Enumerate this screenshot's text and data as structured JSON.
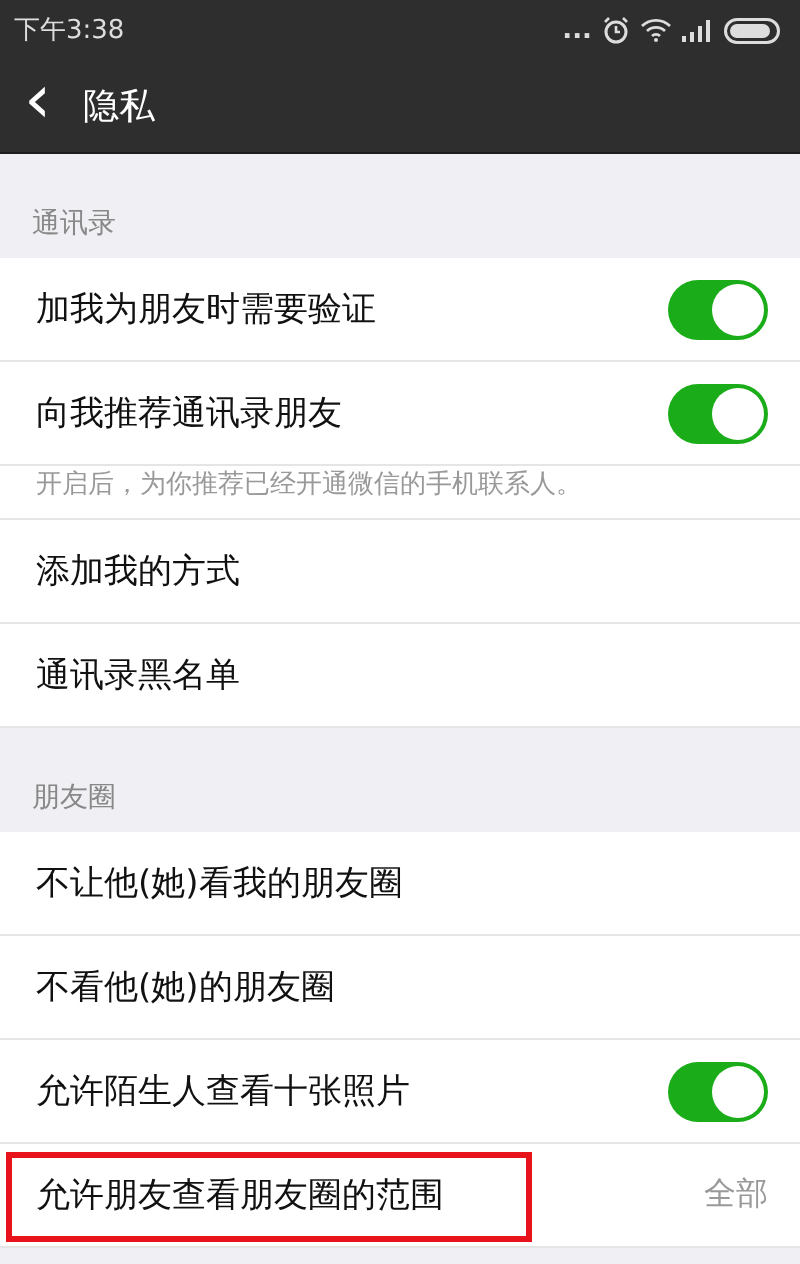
{
  "status_bar": {
    "time": "下午3:38",
    "dots": "..."
  },
  "header": {
    "back": "‹",
    "title": "隐私"
  },
  "sections": [
    {
      "title": "通讯录",
      "items": [
        {
          "kind": "toggle",
          "label": "加我为朋友时需要验证",
          "on": true
        },
        {
          "kind": "toggle",
          "label": "向我推荐通讯录朋友",
          "on": true
        },
        {
          "kind": "hint",
          "label": "开启后，为你推荐已经开通微信的手机联系人。"
        },
        {
          "kind": "link",
          "label": "添加我的方式"
        },
        {
          "kind": "link",
          "label": "通讯录黑名单"
        }
      ]
    },
    {
      "title": "朋友圈",
      "items": [
        {
          "kind": "link",
          "label": "不让他(她)看我的朋友圈"
        },
        {
          "kind": "link",
          "label": "不看他(她)的朋友圈"
        },
        {
          "kind": "toggle",
          "label": "允许陌生人查看十张照片",
          "on": true
        },
        {
          "kind": "value",
          "label": "允许朋友查看朋友圈的范围",
          "value": "全部",
          "highlighted": true
        }
      ]
    }
  ]
}
